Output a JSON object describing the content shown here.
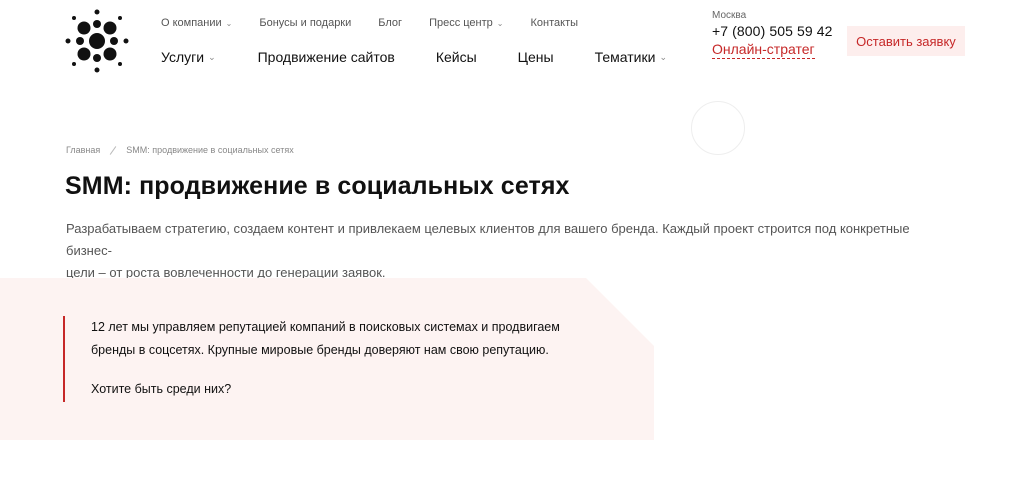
{
  "header": {
    "nav_top": [
      {
        "label": "О компании",
        "dropdown": true
      },
      {
        "label": "Бонусы и подарки",
        "dropdown": false
      },
      {
        "label": "Блог",
        "dropdown": false
      },
      {
        "label": "Пресс центр",
        "dropdown": true
      },
      {
        "label": "Контакты",
        "dropdown": false
      }
    ],
    "nav_main": [
      {
        "label": "Услуги",
        "dropdown": true
      },
      {
        "label": "Продвижение сайтов",
        "dropdown": false
      },
      {
        "label": "Кейсы",
        "dropdown": false
      },
      {
        "label": "Цены",
        "dropdown": false
      },
      {
        "label": "Тематики",
        "dropdown": true
      }
    ],
    "contact": {
      "city": "Москва",
      "phone": "+7 (800) 505 59 42",
      "strateg_label": "Онлайн-стратег"
    },
    "cta_label": "Оставить заявку"
  },
  "breadcrumb": {
    "home": "Главная",
    "current": "SMM: продвижение в социальных сетях"
  },
  "page": {
    "title": "SMM: продвижение в социальных сетях",
    "intro_line1": "Разрабатываем стратегию, создаем контент и привлекаем целевых клиентов для вашего бренда. Каждый проект строится под конкретные бизнес-",
    "intro_line2": "цели – от роста вовлеченности до генерации заявок."
  },
  "quote": {
    "line1": "12 лет мы управляем репутацией компаний в поисковых системах и продвигаем",
    "line2": "бренды в соцсетях. Крупные мировые бренды доверяют нам свою репутацию.",
    "line3": "Хотите быть среди них?"
  },
  "colors": {
    "accent": "#c62828",
    "pink_bg": "#fdf3f2",
    "button_bg": "#fdeeed"
  },
  "icons": {
    "logo": "molecule-dots-logo",
    "dropdown": "chevron-down-icon"
  }
}
